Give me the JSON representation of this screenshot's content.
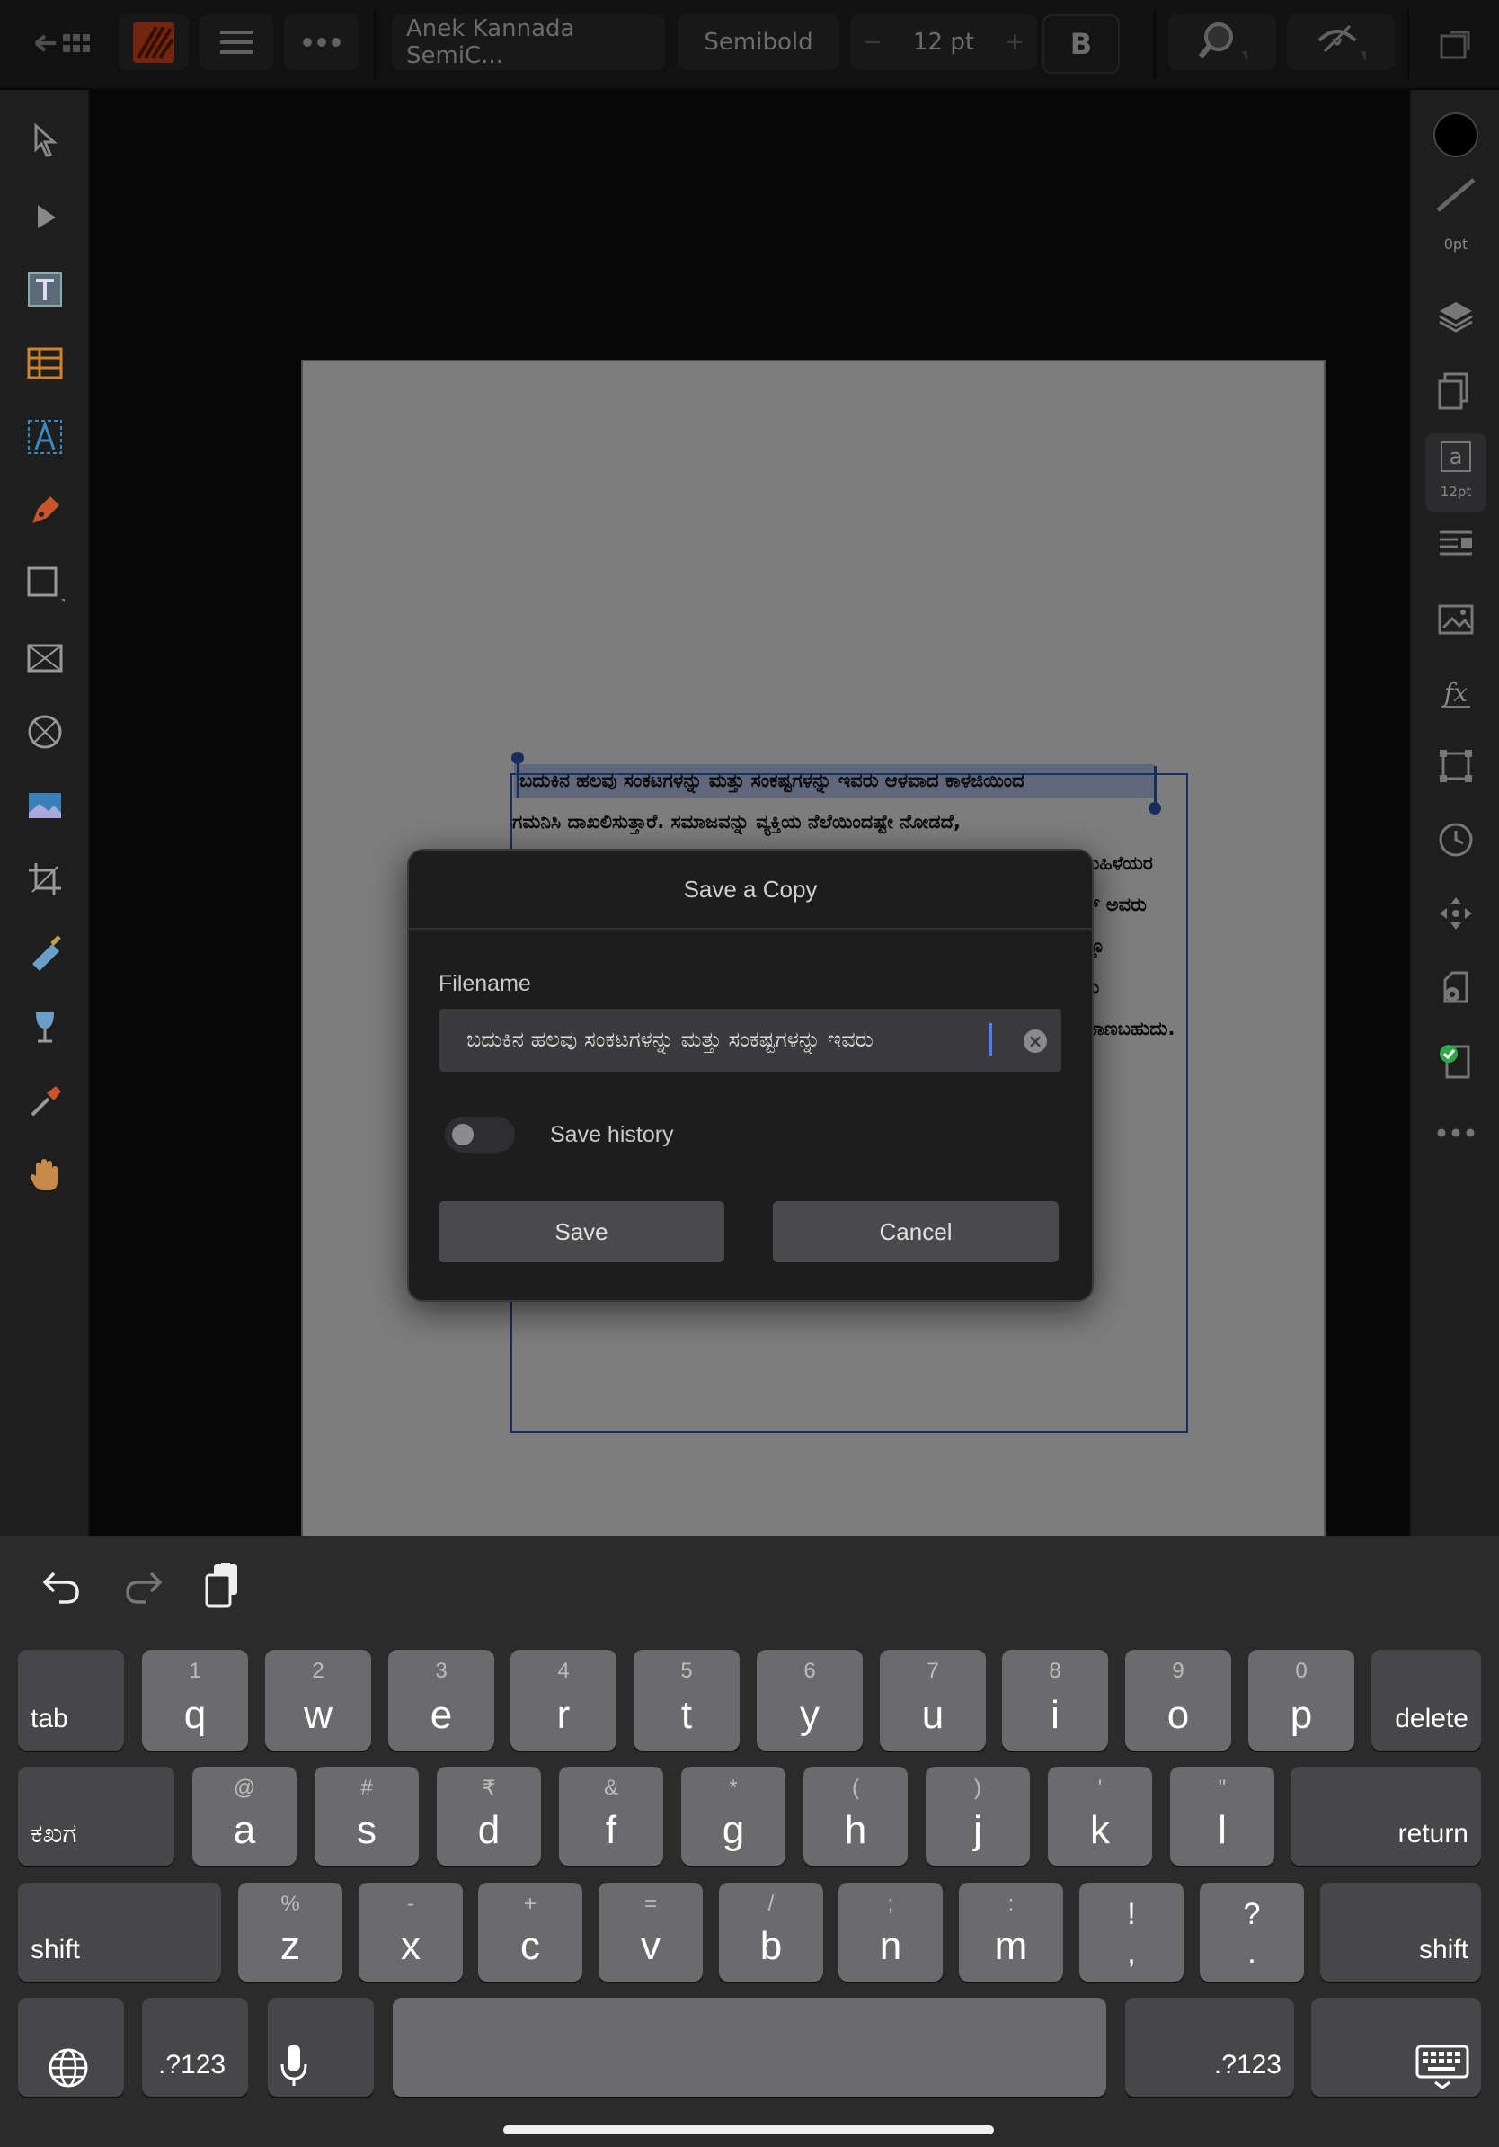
{
  "toolbar": {
    "font_family": "Anek Kannada SemiC...",
    "font_style": "Semibold",
    "font_size": "12 pt",
    "decrease_label": "−",
    "increase_label": "+",
    "bold_label": "B"
  },
  "right_panel": {
    "stroke_width": "0pt",
    "character_size": "12pt"
  },
  "document": {
    "lines": [
      "ಬದುಕಿನ ಹಲವು ಸಂಕಟಗಳನ್ನು ಮತ್ತು ಸಂಕಷ್ಟಗಳನ್ನು ಇವರು ಆಳವಾದ ಕಾಳಜಿಯಿಂದ",
      "ಗಮನಿಸಿ ದಾಖಲಿಸುತ್ತಾರೆ. ಸಮಾಜವನ್ನು ವ್ಯಕ್ತಿಯ ನೆಲೆಯಿಂದಷ್ಟೇ ನೋಡದೆ,",
      "ುಹಿಳೆಯರ",
      "್ ಅವರು",
      "ಲ್ಲೂ",
      "ು",
      "ಕಾಣಬಹುದು."
    ]
  },
  "dialog": {
    "title": "Save a Copy",
    "filename_label": "Filename",
    "filename_value": "ಬದುಕಿನ ಹಲವು ಸಂಕಟಗಳನ್ನು ಮತ್ತು ಸಂಕಷ್ಟಗಳನ್ನು ಇವರು",
    "clear_label": "×",
    "save_history_label": "Save history",
    "save_history_on": false,
    "save_label": "Save",
    "cancel_label": "Cancel"
  },
  "keyboard": {
    "row1": [
      {
        "main": "q",
        "sub": "1"
      },
      {
        "main": "w",
        "sub": "2"
      },
      {
        "main": "e",
        "sub": "3"
      },
      {
        "main": "r",
        "sub": "4"
      },
      {
        "main": "t",
        "sub": "5"
      },
      {
        "main": "y",
        "sub": "6"
      },
      {
        "main": "u",
        "sub": "7"
      },
      {
        "main": "i",
        "sub": "8"
      },
      {
        "main": "o",
        "sub": "9"
      },
      {
        "main": "p",
        "sub": "0"
      }
    ],
    "row2": [
      {
        "main": "a",
        "sub": "@"
      },
      {
        "main": "s",
        "sub": "#"
      },
      {
        "main": "d",
        "sub": "₹"
      },
      {
        "main": "f",
        "sub": "&"
      },
      {
        "main": "g",
        "sub": "*"
      },
      {
        "main": "h",
        "sub": "("
      },
      {
        "main": "j",
        "sub": ")"
      },
      {
        "main": "k",
        "sub": "'"
      },
      {
        "main": "l",
        "sub": "\""
      }
    ],
    "row3": [
      {
        "main": "z",
        "sub": "%"
      },
      {
        "main": "x",
        "sub": "-"
      },
      {
        "main": "c",
        "sub": "+"
      },
      {
        "main": "v",
        "sub": "="
      },
      {
        "main": "b",
        "sub": "/"
      },
      {
        "main": "n",
        "sub": ";"
      },
      {
        "main": "m",
        "sub": ":"
      },
      {
        "main": ",",
        "sub": "!"
      },
      {
        "main": ".",
        "sub": "?"
      }
    ],
    "tab_label": "tab",
    "delete_label": "delete",
    "lang_label": "ಕಖಗ",
    "return_label": "return",
    "shift_label": "shift",
    "numbers_label": ".?123"
  }
}
